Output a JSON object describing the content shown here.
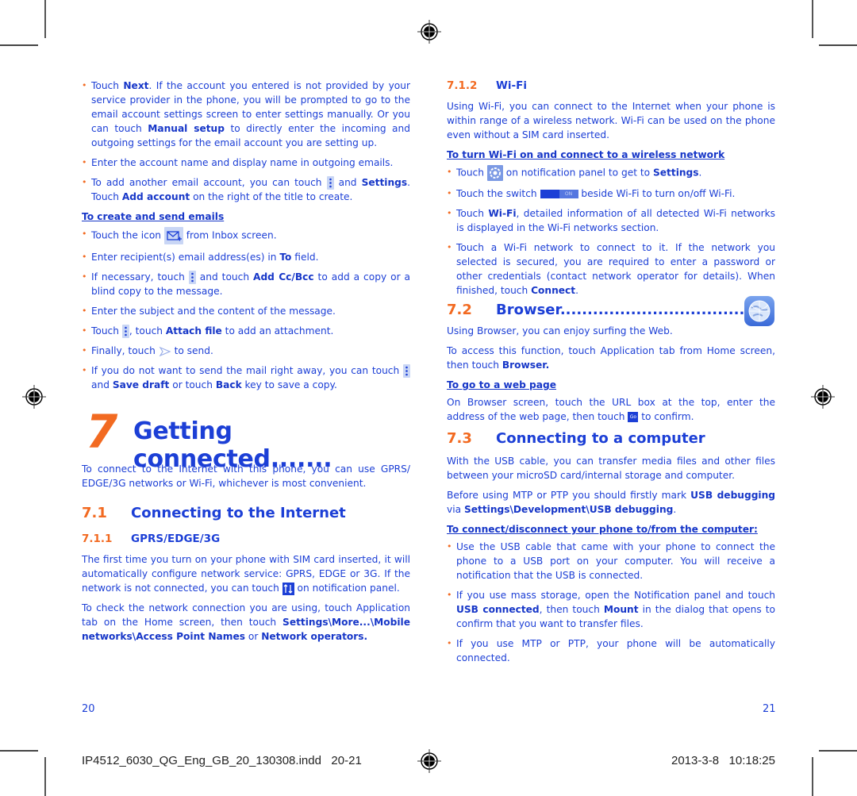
{
  "left": {
    "bullets_top": [
      {
        "parts": [
          "Touch ",
          {
            "b": "Next"
          },
          ". If the account you entered is not provided by your service provider in the phone, you will be prompted to go to the email account settings screen to enter settings manually. Or you can touch ",
          {
            "b": "Manual setup"
          },
          " to directly enter the incoming and outgoing settings for the email account you are setting up."
        ]
      },
      {
        "parts": [
          "Enter the account name and display name in outgoing emails."
        ]
      },
      {
        "parts": [
          "To add another email account, you can touch ",
          {
            "icon": "menu-icon"
          },
          " and ",
          {
            "b": "Settings"
          },
          ". Touch ",
          {
            "b": "Add account"
          },
          " on the right of the title to create."
        ]
      }
    ],
    "create_heading": "To create and send emails",
    "create_bullets": [
      {
        "parts": [
          "Touch the icon ",
          {
            "icon": "compose-email-icon"
          },
          " from Inbox screen."
        ]
      },
      {
        "parts": [
          "Enter recipient(s) email address(es) in ",
          {
            "b": "To"
          },
          " field."
        ]
      },
      {
        "parts": [
          "If necessary, touch ",
          {
            "icon": "menu-icon"
          },
          " and touch ",
          {
            "b": "Add Cc/Bcc"
          },
          " to add a copy or a blind copy to the message."
        ]
      },
      {
        "parts": [
          "Enter the subject and the content of the message."
        ]
      },
      {
        "parts": [
          "Touch ",
          {
            "icon": "menu-icon"
          },
          ", touch ",
          {
            "b": "Attach file"
          },
          " to add an attachment."
        ]
      },
      {
        "parts": [
          "Finally, touch ",
          {
            "icon": "send-icon"
          },
          " to send."
        ]
      },
      {
        "parts": [
          "If you do not want to send the mail right away, you can touch ",
          {
            "icon": "menu-icon"
          },
          " and ",
          {
            "b": "Save draft"
          },
          " or touch ",
          {
            "b": "Back"
          },
          " key to save a copy."
        ]
      }
    ],
    "chapter_number": "7",
    "chapter_title": "Getting connected.......",
    "chapter_intro": "To connect to the Internet with this phone, you can use GPRS/ EDGE/3G networks or Wi-Fi, whichever is most convenient.",
    "sec71_num": "7.1",
    "sec71_title": "Connecting to the Internet",
    "sec711_num": "7.1.1",
    "sec711_title": "GPRS/EDGE/3G",
    "sec711_paras": [
      {
        "parts": [
          "The first time you turn on your phone with SIM card inserted, it will automatically configure network service: GPRS, EDGE or 3G. If the network is not connected, you can touch ",
          {
            "icon": "mobile-data-icon"
          },
          " on notification panel."
        ]
      },
      {
        "parts": [
          "To check the network connection you are using, touch Application tab on the Home screen, then touch ",
          {
            "b": "Settings\\More...\\Mobile networks\\Access Point Names"
          },
          " or ",
          {
            "b": "Network operators."
          }
        ]
      }
    ],
    "page_number": "20"
  },
  "right": {
    "sec712_num": "7.1.2",
    "sec712_title": "Wi-Fi",
    "wifi_intro": "Using Wi-Fi, you can connect to the Internet when your phone is within range of a wireless network. Wi-Fi can be used on the phone even without a SIM card inserted.",
    "wifi_heading": "To turn Wi-Fi on and connect to a wireless network",
    "wifi_bullets": [
      {
        "parts": [
          "Touch ",
          {
            "icon": "settings-icon"
          },
          " on notification panel to get to ",
          {
            "b": "Settings"
          },
          "."
        ]
      },
      {
        "parts": [
          "Touch the switch ",
          {
            "icon": "on-switch-icon"
          },
          " beside Wi-Fi to  turn on/off Wi-Fi."
        ]
      },
      {
        "parts": [
          "Touch ",
          {
            "b": "Wi-Fi"
          },
          ", detailed information of all detected Wi-Fi networks is displayed in the Wi-Fi networks section."
        ]
      },
      {
        "parts": [
          "Touch a Wi-Fi network to connect to it. If the network you selected is secured, you are required to enter a password or other credentials (contact network operator for details). When finished, touch ",
          {
            "b": "Connect"
          },
          "."
        ]
      }
    ],
    "sec72_num": "7.2",
    "sec72_title": "Browser....................................",
    "browser_paras": [
      {
        "parts": [
          "Using Browser, you can enjoy surfing the Web."
        ]
      },
      {
        "parts": [
          "To access this function, touch Application tab from Home screen, then touch ",
          {
            "b": "Browser."
          }
        ]
      }
    ],
    "web_heading": "To go to a web page",
    "web_para": {
      "parts": [
        "On Browser screen, touch the URL box at the top, enter the address of the web page, then touch ",
        {
          "icon": "go-icon"
        },
        " to confirm."
      ]
    },
    "sec73_num": "7.3",
    "sec73_title": "Connecting to a computer",
    "computer_paras": [
      {
        "parts": [
          "With the USB cable, you can transfer media files and other files between your microSD card/internal storage and computer."
        ]
      },
      {
        "parts": [
          "Before using MTP or PTP you should firstly mark ",
          {
            "b": "USB debugging"
          },
          " via ",
          {
            "b": "Settings\\Development\\USB debugging"
          },
          "."
        ]
      }
    ],
    "connect_heading": "To connect/disconnect your phone to/from the computer:",
    "connect_bullets": [
      {
        "parts": [
          "Use the USB cable that came with your phone to connect the phone to a USB port on your computer. You will receive a notification that the USB is connected."
        ]
      },
      {
        "parts": [
          "If you use mass storage, open the Notification panel and touch ",
          {
            "b": "USB connected"
          },
          ", then touch ",
          {
            "b": "Mount"
          },
          " in the dialog that opens to confirm that you want to transfer files."
        ]
      },
      {
        "parts": [
          "If you use MTP or PTP, your phone will be automatically connected."
        ]
      }
    ],
    "page_number": "21"
  },
  "slug": {
    "filename": "IP4512_6030_QG_Eng_GB_20_130308.indd   20-21",
    "timestamp": "2013-3-8   10:18:25"
  },
  "colors": {
    "text": "#1c3fd6",
    "accent": "#f26a21"
  },
  "switch_label": "ON",
  "go_label": "Go"
}
